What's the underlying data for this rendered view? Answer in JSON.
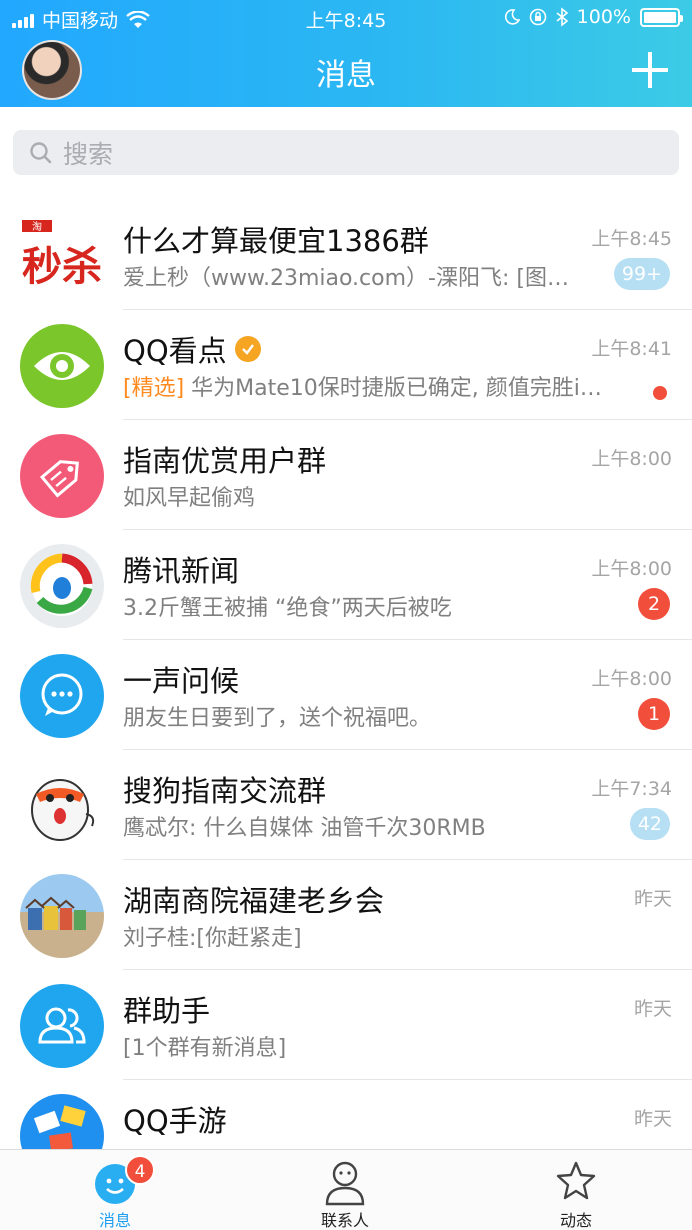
{
  "status_bar": {
    "carrier": "中国移动",
    "time": "上午8:45",
    "battery": "100%"
  },
  "header": {
    "title": "消息"
  },
  "search": {
    "placeholder": "搜索"
  },
  "conversations": [
    {
      "name": "什么才算最便宜1386群",
      "message": "爱上秒（www.23miao.com）-溧阳飞: [图…",
      "time": "上午8:45",
      "badge": "99+",
      "badge_style": "muted",
      "avatar_icon": "miaosha-logo"
    },
    {
      "name": "QQ看点",
      "tag": "[精选]",
      "message": "华为Mate10保时捷版已确定, 颜值完胜i…",
      "time": "上午8:41",
      "verified": true,
      "unread_dot": true,
      "avatar_icon": "eye-icon"
    },
    {
      "name": "指南优赏用户群",
      "message": "如风早起偷鸡",
      "time": "上午8:00",
      "avatar_icon": "tag-icon"
    },
    {
      "name": "腾讯新闻",
      "message": "3.2斤蟹王被捕 “绝食”两天后被吃",
      "time": "上午8:00",
      "badge": "2",
      "badge_style": "red",
      "avatar_icon": "tencent-news-logo"
    },
    {
      "name": "一声问候",
      "message": "朋友生日要到了，送个祝福吧。",
      "time": "上午8:00",
      "badge": "1",
      "badge_style": "red",
      "avatar_icon": "chat-bubble-icon"
    },
    {
      "name": "搜狗指南交流群",
      "message": "鹰忒尔: 什么自媒体 油管千次30RMB",
      "time": "上午7:34",
      "badge": "42",
      "badge_style": "muted",
      "avatar_icon": "sogou-dog-avatar"
    },
    {
      "name": "湖南商院福建老乡会",
      "message": "刘子桂:[你赶紧走]",
      "time": "昨天",
      "avatar_icon": "beach-huts-photo"
    },
    {
      "name": "群助手",
      "message": "[1个群有新消息]",
      "message_highlight": true,
      "time": "昨天",
      "avatar_icon": "group-icon"
    },
    {
      "name": "QQ手游",
      "message": "",
      "time": "昨天",
      "avatar_icon": "game-cards-icon"
    }
  ],
  "tabbar": {
    "tabs": [
      {
        "label": "消息",
        "icon": "smile-bubble-icon",
        "badge": "4",
        "active": true
      },
      {
        "label": "联系人",
        "icon": "person-icon"
      },
      {
        "label": "动态",
        "icon": "star-icon"
      }
    ]
  },
  "colors": {
    "header_start": "#22a8ff",
    "header_end": "#3ccbe6",
    "badge_red": "#f14f3c",
    "accent_blue": "#1e9ef0",
    "tag_orange": "#ff8a1f"
  }
}
